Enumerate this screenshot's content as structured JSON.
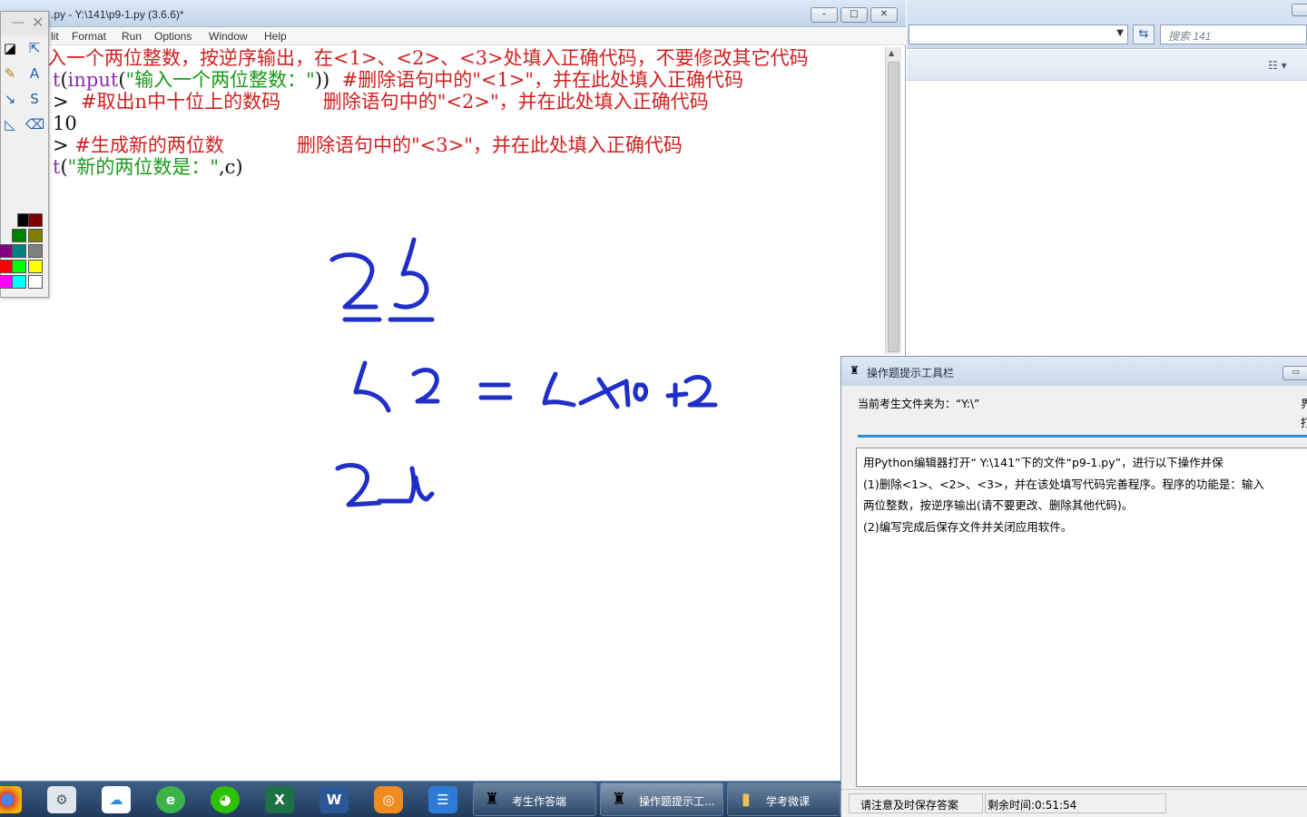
{
  "idle": {
    "title": ".py - Y:\\141\\p9-1.py (3.6.6)*",
    "menu": [
      "lit",
      "Format",
      "Run",
      "Options",
      "Window",
      "Help"
    ],
    "code_lines": [
      [
        {
          "text": "入一个两位整数，按逆序输出，在<1>、<2>、<3>处填入正确代码，不要修改其它代码",
          "color": "red"
        }
      ],
      [
        {
          "text": "t",
          "color": "purple"
        },
        {
          "text": "(",
          "color": "black"
        },
        {
          "text": "input",
          "color": "purple"
        },
        {
          "text": "(",
          "color": "black"
        },
        {
          "text": "\"输入一个两位整数：\"",
          "color": "green"
        },
        {
          "text": "))  ",
          "color": "black"
        },
        {
          "text": "#删除语句中的\"<1>\"，并在此处填入正确代码",
          "color": "red"
        }
      ],
      [
        {
          "text": ">  ",
          "color": "black"
        },
        {
          "text": "#取出n中十位上的数码       删除语句中的\"<2>\"，并在此处填入正确代码",
          "color": "red"
        }
      ],
      [
        {
          "text": "10",
          "color": "black"
        }
      ],
      [
        {
          "text": "> ",
          "color": "black"
        },
        {
          "text": "#生成新的两位数            删除语句中的\"<3>\"，并在此处填入正确代码",
          "color": "red"
        }
      ],
      [
        {
          "text": "t",
          "color": "purple"
        },
        {
          "text": "(",
          "color": "black"
        },
        {
          "text": "\"新的两位数是：\"",
          "color": "green"
        },
        {
          "text": ",c)",
          "color": "black"
        }
      ]
    ],
    "window_buttons": {
      "minimize": "–",
      "maximize": "□",
      "close": "✕"
    }
  },
  "palette": {
    "close_glyph": "✕",
    "minimize_glyph": "—",
    "swatch_colors": [
      "#000000",
      "#800000",
      "#008000",
      "#808000",
      "#800080",
      "#008080",
      "#808080",
      "#ff0000",
      "#00ff00",
      "#ffff00",
      "#ff00ff",
      "#00ffff",
      "#ffffff"
    ]
  },
  "explorer": {
    "search_placeholder": "搜索 141"
  },
  "hint": {
    "title": "操作题提示工具栏",
    "folder_label": "当前考生文件夹为：“Y:\\”",
    "right_label_1": "界",
    "right_label_2": "打",
    "instructions": [
      "用Python编辑器打开“ Y:\\141”下的文件“p9-1.py”，进行以下操作并保",
      "(1)删除<1>、<2>、<3>，并在该处填写代码完善程序。程序的功能是：输入",
      "两位整数，按逆序输出(请不要更改、删除其他代码)。",
      "(2)编写完成后保存文件并关闭应用软件。"
    ],
    "status_reminder": "请注意及时保存答案",
    "time_remaining": "剩余时间:0:51:54"
  },
  "taskbar": {
    "tasks": [
      {
        "label": "考生作答端"
      },
      {
        "label": "操作题提示工..."
      },
      {
        "label": "学考微课"
      }
    ]
  },
  "colors": {
    "handwriting": "#1f2fc8",
    "taskbar": "#2a4a70",
    "accent": "#2f8fd5"
  }
}
